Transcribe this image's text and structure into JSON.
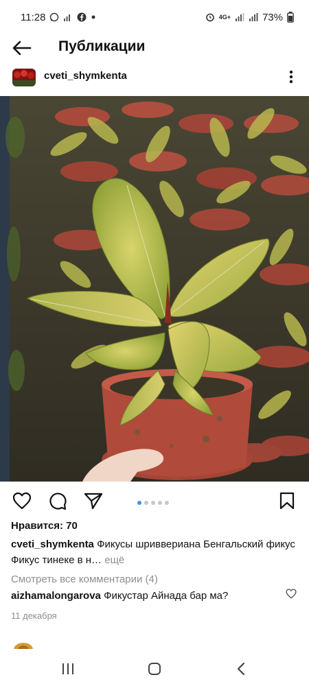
{
  "status_bar": {
    "time": "11:28",
    "battery": "73%",
    "network": "4G+",
    "icons": [
      "whatsapp-icon",
      "signal-icon",
      "facebook-icon",
      "dot-icon",
      "alarm-icon",
      "network-icon",
      "signal-icon",
      "signal-icon",
      "battery-icon"
    ]
  },
  "header": {
    "title": "Публикации",
    "back_icon": "back-arrow-icon"
  },
  "post": {
    "username": "cveti_shymkenta",
    "more_icon": "more-vertical-icon",
    "carousel": {
      "count": 5,
      "active_index": 0
    },
    "likes_text": "Нравится: 70",
    "caption_user": "cveti_shymkenta",
    "caption_text": "Фикусы шриввериана Бенгальский фикус Фикус тинеке в н…",
    "caption_more": "ещё",
    "view_comments": "Смотреть все комментарии (4)",
    "comment_user": "aizhamalongarova",
    "comment_text": "Фикустар Айнада бар ма?",
    "date": "11 декабря"
  },
  "actions": {
    "like_icon": "heart-icon",
    "comment_icon": "comment-icon",
    "share_icon": "send-icon",
    "save_icon": "bookmark-icon"
  },
  "nav_bar": {
    "icons": [
      "recent-apps-icon",
      "home-icon",
      "back-icon"
    ]
  },
  "colors": {
    "accent": "#3897f0",
    "muted_text": "#8e8e8e",
    "text": "#111111"
  }
}
